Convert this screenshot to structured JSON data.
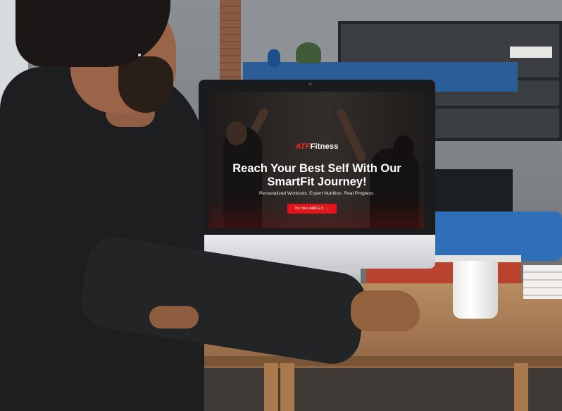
{
  "screen": {
    "logo_mark": "ATF",
    "logo_text": "Fitness",
    "headline_line1": "Reach Your Best Self With Our",
    "headline_line2": "SmartFit Journey!",
    "subline": "Personalized Workouts. Expert Nutrition. Real Progress.",
    "cta_label": "Try Your AMFG.5",
    "cta_arrow": "→"
  },
  "colors": {
    "brand_red": "#e0161b",
    "text_white": "#ffffff"
  }
}
